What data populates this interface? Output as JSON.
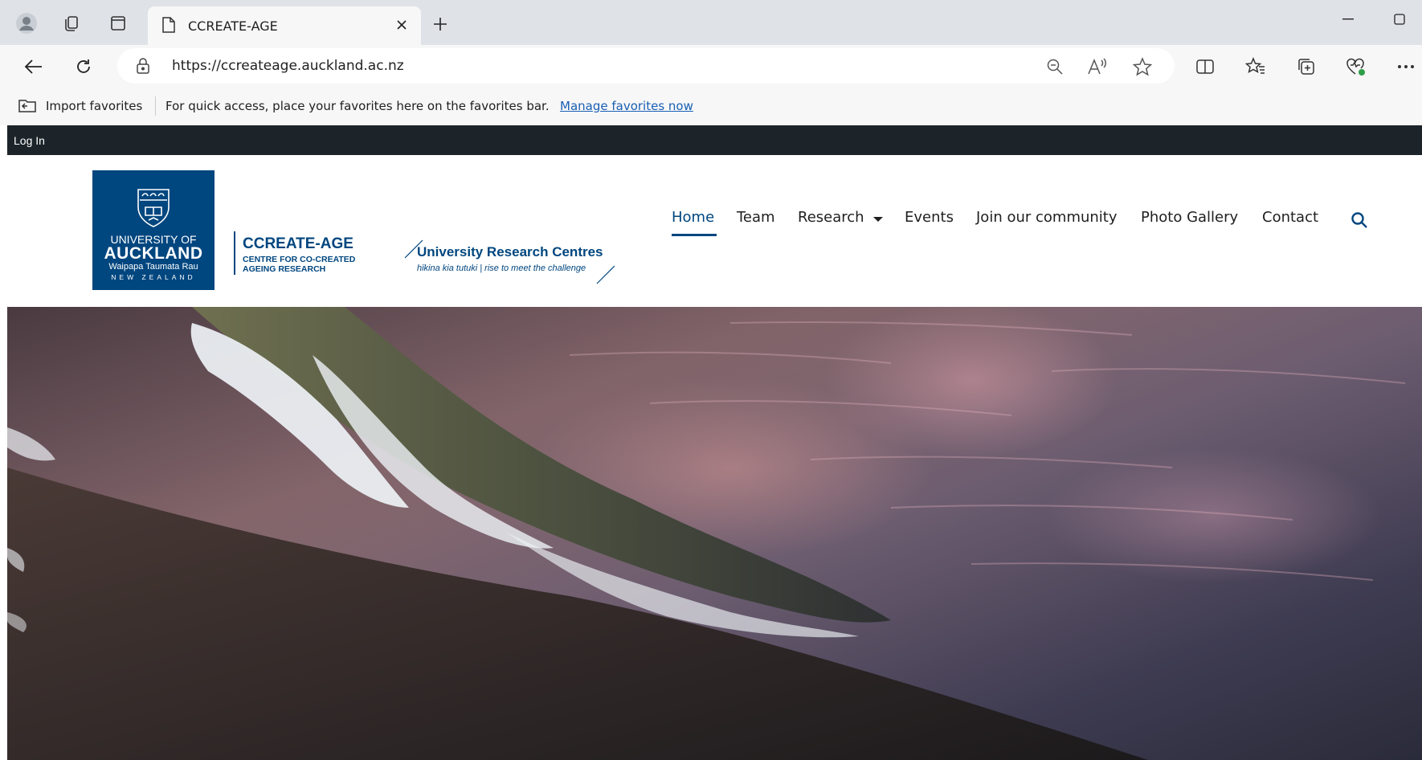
{
  "browser": {
    "tab_title": "CCREATE-AGE",
    "url": "https://ccreateage.auckland.ac.nz",
    "favorites_bar": {
      "import_label": "Import favorites",
      "message": "For quick access, place your favorites here on the favorites bar.",
      "manage_link": "Manage favorites now"
    }
  },
  "site": {
    "top_strip": {
      "login": "Log In"
    },
    "uoa_logo": {
      "line1": "UNIVERSITY OF",
      "line2": "AUCKLAND",
      "line3": "Waipapa Taumata Rau",
      "line4": "NEW ZEALAND"
    },
    "ccreate_logo": {
      "title": "CCREATE-AGE",
      "sub1": "CENTRE FOR CO-CREATED",
      "sub2": "AGEING RESEARCH"
    },
    "urc_logo": {
      "title": "University Research Centres",
      "tagline": "hīkina kia tutuki | rise to meet the challenge"
    },
    "nav": {
      "home": "Home",
      "team": "Team",
      "research": "Research",
      "events": "Events",
      "community": "Join our community",
      "gallery": "Photo Gallery",
      "contact": "Contact"
    },
    "colors": {
      "brand": "#00467f",
      "top_strip": "#1c2429"
    }
  }
}
